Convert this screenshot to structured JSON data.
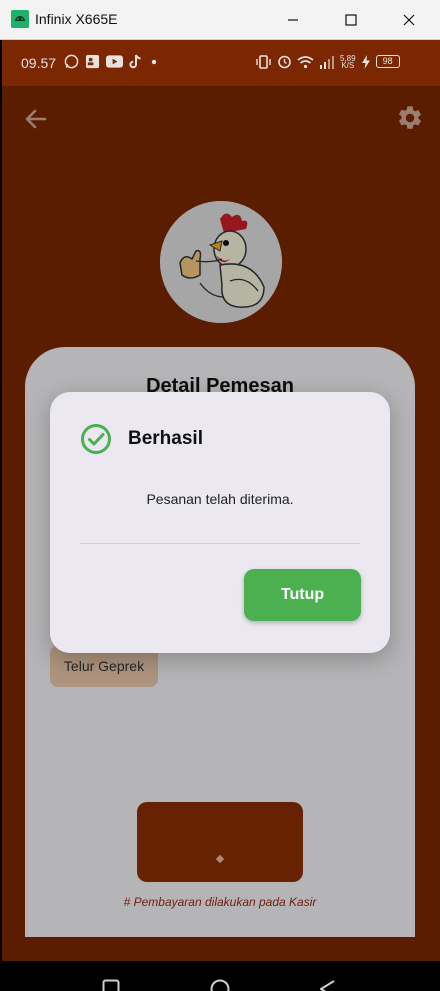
{
  "window": {
    "title": "Infinix X665E"
  },
  "statusbar": {
    "time": "09.57",
    "network_speed_value": "5,89",
    "network_speed_unit": "K/S",
    "battery": "98"
  },
  "page": {
    "card_title": "Detail Pemesan",
    "menu_item": "Telur Geprek",
    "payment_note": "# Pembayaran dilakukan pada Kasir"
  },
  "dialog": {
    "title": "Berhasil",
    "message": "Pesanan telah diterima.",
    "close_button": "Tutup"
  },
  "icons": {
    "back": "arrow-left-icon",
    "settings": "gear-icon",
    "success": "check-circle-icon"
  },
  "colors": {
    "app_background": "#7a2702",
    "card": "#f2f2f5",
    "dialog": "#ebe8f2",
    "success_green": "#4caf50"
  }
}
